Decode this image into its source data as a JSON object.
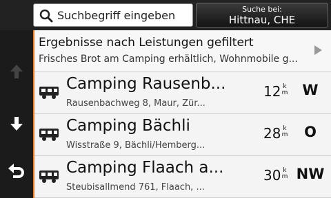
{
  "search": {
    "placeholder": "Suchbegriff eingeben"
  },
  "near": {
    "label": "Suche bei:",
    "location": "Hittnau, CHE"
  },
  "filter": {
    "title": "Ergebnisse nach Leistungen gefiltert",
    "subtitle": "Frisches Brot am Camping erhältlich, Wohnmobile g..."
  },
  "results": [
    {
      "name": "Camping Rausenb...",
      "address": "Rausenbachweg 8, Maur, Zür...",
      "distance": "12",
      "unit_top": "k",
      "unit_bottom": "m",
      "direction": "W",
      "icon": "rv-icon"
    },
    {
      "name": "Camping Bächli",
      "address": "Wisstraße 9, Bächli/Hemberg...",
      "distance": "28",
      "unit_top": "k",
      "unit_bottom": "m",
      "direction": "O",
      "icon": "rv-icon"
    },
    {
      "name": "Camping Flaach a...",
      "address": "Steubisallmend 761, Flaach, ...",
      "distance": "30",
      "unit_top": "k",
      "unit_bottom": "m",
      "direction": "NW",
      "icon": "rv-icon"
    }
  ],
  "sidebar": {
    "icons": [
      "scroll-up-icon",
      "scroll-down-icon",
      "back-icon"
    ]
  },
  "colors": {
    "accent": "#f07a1c",
    "background": "#1b1b1b",
    "list": "#f4f4f4"
  }
}
